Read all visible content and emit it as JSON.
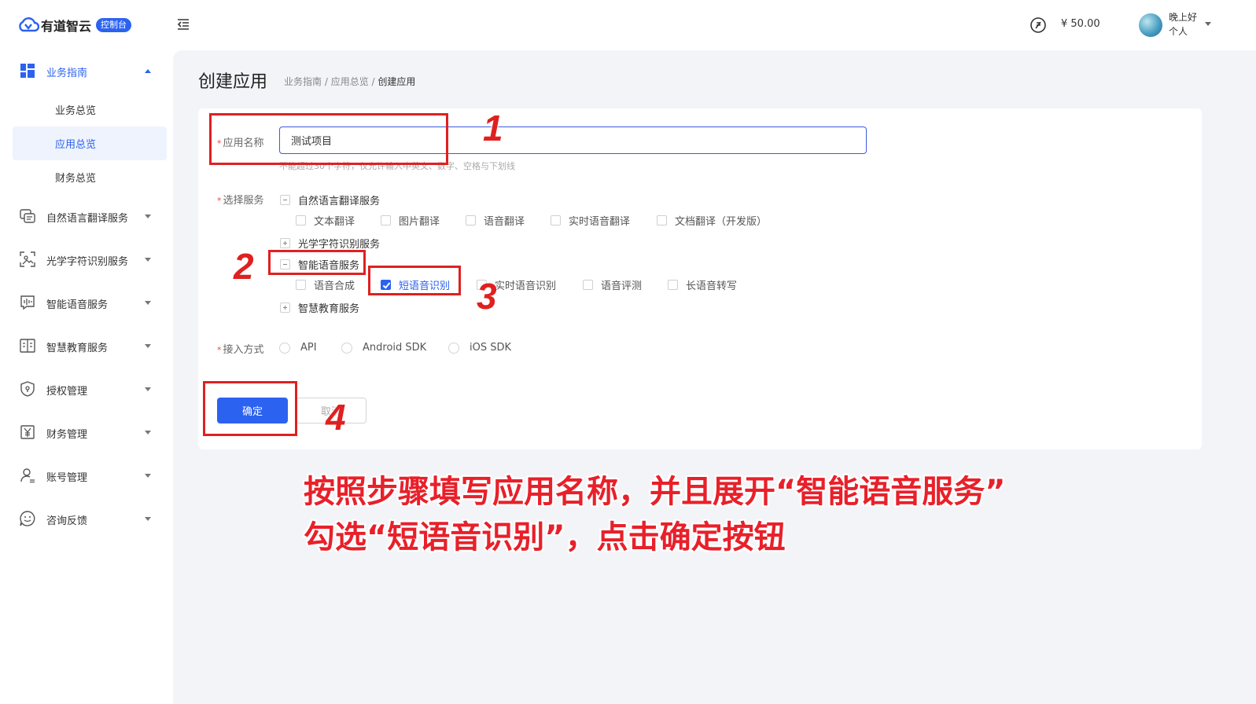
{
  "header": {
    "logo_text": "有道智云",
    "logo_tag": "控制台",
    "balance": "¥ 50.00",
    "greeting": "晚上好",
    "account_type": "个人"
  },
  "sidebar": {
    "guide": {
      "label": "业务指南",
      "icon": "dashboard-grid-icon"
    },
    "sub_items": [
      {
        "label": "业务总览"
      },
      {
        "label": "应用总览"
      },
      {
        "label": "财务总览"
      }
    ],
    "items": [
      {
        "label": "自然语言翻译服务",
        "icon": "translate-icon"
      },
      {
        "label": "光学字符识别服务",
        "icon": "ocr-scan-icon"
      },
      {
        "label": "智能语音服务",
        "icon": "voice-wave-icon"
      },
      {
        "label": "智慧教育服务",
        "icon": "education-book-icon"
      },
      {
        "label": "授权管理",
        "icon": "shield-icon"
      },
      {
        "label": "财务管理",
        "icon": "yen-icon"
      },
      {
        "label": "账号管理",
        "icon": "user-icon"
      },
      {
        "label": "咨询反馈",
        "icon": "smile-chat-icon"
      }
    ]
  },
  "page": {
    "title": "创建应用",
    "breadcrumb": {
      "part1": "业务指南",
      "sep1": " / ",
      "part2": "应用总览",
      "sep2": " / ",
      "current": "创建应用"
    }
  },
  "form": {
    "required_mark": "*",
    "name_label": "应用名称",
    "name_value": "测试项目",
    "name_hint": "不能超过30个字符，仅允许输入中英文、数字、空格与下划线",
    "service_label": "选择服务",
    "groups": {
      "translation": {
        "label": "自然语言翻译服务",
        "options": [
          "文本翻译",
          "图片翻译",
          "语音翻译",
          "实时语音翻译",
          "文档翻译（开发版）"
        ]
      },
      "ocr": {
        "label": "光学字符识别服务"
      },
      "voice": {
        "label": "智能语音服务",
        "options": [
          "语音合成",
          "短语音识别",
          "实时语音识别",
          "语音评测",
          "长语音转写"
        ],
        "checked": "短语音识别"
      },
      "education": {
        "label": "智慧教育服务"
      }
    },
    "access_label": "接入方式",
    "access_options": [
      "API",
      "Android SDK",
      "iOS SDK"
    ],
    "ok_label": "确定",
    "cancel_label": "取消"
  },
  "annotations": {
    "step1": "1",
    "step2": "2",
    "step3": "3",
    "step4": "4",
    "caption_line1": "按照步骤填写应用名称，并且展开“智能语音服务”",
    "caption_line2": "勾选“短语音识别”，点击确定按钮",
    "color": "#e02020"
  },
  "colors": {
    "primary": "#2b62f0",
    "background": "#f3f4f8",
    "annotation_red": "#e02020"
  }
}
